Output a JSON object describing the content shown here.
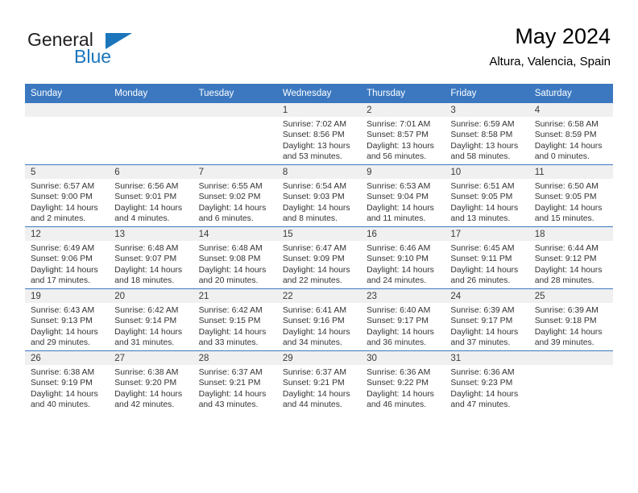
{
  "brand": {
    "name_part1": "General",
    "name_part2": "Blue",
    "triangle_color": "#1b75bb"
  },
  "header": {
    "month_title": "May 2024",
    "location": "Altura, Valencia, Spain",
    "header_bg": "#3b78c0",
    "date_strip_bg": "#f0f0f0"
  },
  "weekdays": [
    "Sunday",
    "Monday",
    "Tuesday",
    "Wednesday",
    "Thursday",
    "Friday",
    "Saturday"
  ],
  "calendar_weeks": [
    [
      {
        "day": "",
        "empty": true
      },
      {
        "day": "",
        "empty": true
      },
      {
        "day": "",
        "empty": true
      },
      {
        "day": "1",
        "sunrise": "Sunrise: 7:02 AM",
        "sunset": "Sunset: 8:56 PM",
        "daylight1": "Daylight: 13 hours",
        "daylight2": "and 53 minutes."
      },
      {
        "day": "2",
        "sunrise": "Sunrise: 7:01 AM",
        "sunset": "Sunset: 8:57 PM",
        "daylight1": "Daylight: 13 hours",
        "daylight2": "and 56 minutes."
      },
      {
        "day": "3",
        "sunrise": "Sunrise: 6:59 AM",
        "sunset": "Sunset: 8:58 PM",
        "daylight1": "Daylight: 13 hours",
        "daylight2": "and 58 minutes."
      },
      {
        "day": "4",
        "sunrise": "Sunrise: 6:58 AM",
        "sunset": "Sunset: 8:59 PM",
        "daylight1": "Daylight: 14 hours",
        "daylight2": "and 0 minutes."
      }
    ],
    [
      {
        "day": "5",
        "sunrise": "Sunrise: 6:57 AM",
        "sunset": "Sunset: 9:00 PM",
        "daylight1": "Daylight: 14 hours",
        "daylight2": "and 2 minutes."
      },
      {
        "day": "6",
        "sunrise": "Sunrise: 6:56 AM",
        "sunset": "Sunset: 9:01 PM",
        "daylight1": "Daylight: 14 hours",
        "daylight2": "and 4 minutes."
      },
      {
        "day": "7",
        "sunrise": "Sunrise: 6:55 AM",
        "sunset": "Sunset: 9:02 PM",
        "daylight1": "Daylight: 14 hours",
        "daylight2": "and 6 minutes."
      },
      {
        "day": "8",
        "sunrise": "Sunrise: 6:54 AM",
        "sunset": "Sunset: 9:03 PM",
        "daylight1": "Daylight: 14 hours",
        "daylight2": "and 8 minutes."
      },
      {
        "day": "9",
        "sunrise": "Sunrise: 6:53 AM",
        "sunset": "Sunset: 9:04 PM",
        "daylight1": "Daylight: 14 hours",
        "daylight2": "and 11 minutes."
      },
      {
        "day": "10",
        "sunrise": "Sunrise: 6:51 AM",
        "sunset": "Sunset: 9:05 PM",
        "daylight1": "Daylight: 14 hours",
        "daylight2": "and 13 minutes."
      },
      {
        "day": "11",
        "sunrise": "Sunrise: 6:50 AM",
        "sunset": "Sunset: 9:05 PM",
        "daylight1": "Daylight: 14 hours",
        "daylight2": "and 15 minutes."
      }
    ],
    [
      {
        "day": "12",
        "sunrise": "Sunrise: 6:49 AM",
        "sunset": "Sunset: 9:06 PM",
        "daylight1": "Daylight: 14 hours",
        "daylight2": "and 17 minutes."
      },
      {
        "day": "13",
        "sunrise": "Sunrise: 6:48 AM",
        "sunset": "Sunset: 9:07 PM",
        "daylight1": "Daylight: 14 hours",
        "daylight2": "and 18 minutes."
      },
      {
        "day": "14",
        "sunrise": "Sunrise: 6:48 AM",
        "sunset": "Sunset: 9:08 PM",
        "daylight1": "Daylight: 14 hours",
        "daylight2": "and 20 minutes."
      },
      {
        "day": "15",
        "sunrise": "Sunrise: 6:47 AM",
        "sunset": "Sunset: 9:09 PM",
        "daylight1": "Daylight: 14 hours",
        "daylight2": "and 22 minutes."
      },
      {
        "day": "16",
        "sunrise": "Sunrise: 6:46 AM",
        "sunset": "Sunset: 9:10 PM",
        "daylight1": "Daylight: 14 hours",
        "daylight2": "and 24 minutes."
      },
      {
        "day": "17",
        "sunrise": "Sunrise: 6:45 AM",
        "sunset": "Sunset: 9:11 PM",
        "daylight1": "Daylight: 14 hours",
        "daylight2": "and 26 minutes."
      },
      {
        "day": "18",
        "sunrise": "Sunrise: 6:44 AM",
        "sunset": "Sunset: 9:12 PM",
        "daylight1": "Daylight: 14 hours",
        "daylight2": "and 28 minutes."
      }
    ],
    [
      {
        "day": "19",
        "sunrise": "Sunrise: 6:43 AM",
        "sunset": "Sunset: 9:13 PM",
        "daylight1": "Daylight: 14 hours",
        "daylight2": "and 29 minutes."
      },
      {
        "day": "20",
        "sunrise": "Sunrise: 6:42 AM",
        "sunset": "Sunset: 9:14 PM",
        "daylight1": "Daylight: 14 hours",
        "daylight2": "and 31 minutes."
      },
      {
        "day": "21",
        "sunrise": "Sunrise: 6:42 AM",
        "sunset": "Sunset: 9:15 PM",
        "daylight1": "Daylight: 14 hours",
        "daylight2": "and 33 minutes."
      },
      {
        "day": "22",
        "sunrise": "Sunrise: 6:41 AM",
        "sunset": "Sunset: 9:16 PM",
        "daylight1": "Daylight: 14 hours",
        "daylight2": "and 34 minutes."
      },
      {
        "day": "23",
        "sunrise": "Sunrise: 6:40 AM",
        "sunset": "Sunset: 9:17 PM",
        "daylight1": "Daylight: 14 hours",
        "daylight2": "and 36 minutes."
      },
      {
        "day": "24",
        "sunrise": "Sunrise: 6:39 AM",
        "sunset": "Sunset: 9:17 PM",
        "daylight1": "Daylight: 14 hours",
        "daylight2": "and 37 minutes."
      },
      {
        "day": "25",
        "sunrise": "Sunrise: 6:39 AM",
        "sunset": "Sunset: 9:18 PM",
        "daylight1": "Daylight: 14 hours",
        "daylight2": "and 39 minutes."
      }
    ],
    [
      {
        "day": "26",
        "sunrise": "Sunrise: 6:38 AM",
        "sunset": "Sunset: 9:19 PM",
        "daylight1": "Daylight: 14 hours",
        "daylight2": "and 40 minutes."
      },
      {
        "day": "27",
        "sunrise": "Sunrise: 6:38 AM",
        "sunset": "Sunset: 9:20 PM",
        "daylight1": "Daylight: 14 hours",
        "daylight2": "and 42 minutes."
      },
      {
        "day": "28",
        "sunrise": "Sunrise: 6:37 AM",
        "sunset": "Sunset: 9:21 PM",
        "daylight1": "Daylight: 14 hours",
        "daylight2": "and 43 minutes."
      },
      {
        "day": "29",
        "sunrise": "Sunrise: 6:37 AM",
        "sunset": "Sunset: 9:21 PM",
        "daylight1": "Daylight: 14 hours",
        "daylight2": "and 44 minutes."
      },
      {
        "day": "30",
        "sunrise": "Sunrise: 6:36 AM",
        "sunset": "Sunset: 9:22 PM",
        "daylight1": "Daylight: 14 hours",
        "daylight2": "and 46 minutes."
      },
      {
        "day": "31",
        "sunrise": "Sunrise: 6:36 AM",
        "sunset": "Sunset: 9:23 PM",
        "daylight1": "Daylight: 14 hours",
        "daylight2": "and 47 minutes."
      },
      {
        "day": "",
        "empty": true
      }
    ]
  ]
}
